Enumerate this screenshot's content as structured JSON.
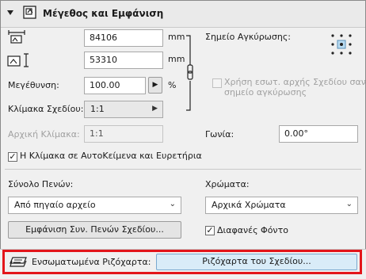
{
  "header": {
    "title": "Μέγεθος και Εμφάνιση"
  },
  "size": {
    "width_value": "84106",
    "width_unit": "mm",
    "height_value": "53310",
    "height_unit": "mm",
    "magnification_label": "Μεγέθυνση:",
    "magnification_value": "100.00",
    "magnification_unit": "%",
    "drawing_scale_label": "Κλίμακα Σχεδίου:",
    "drawing_scale_value": "1:1",
    "original_scale_label": "Αρχική Κλίμακα:",
    "original_scale_value": "1:1"
  },
  "anchor": {
    "label": "Σημείο Αγκύρωσης:",
    "use_origin_label_line1": "Χρήση εσωτ. αρχής Σχεδίου σαν",
    "use_origin_label_line2": "σημείο αγκύρωσης",
    "angle_label": "Γωνία:",
    "angle_value": "0.00°"
  },
  "scale_text_checkbox": {
    "label": "Η Κλίμακα σε ΑυτοΚείμενα και Ευρετήρια",
    "checked": true
  },
  "pens": {
    "label": "Σύνολο Πενών:",
    "selected": "Από πηγαίο αρχείο",
    "show_button": "Εμφάνιση Συν. Πενών Σχεδίου..."
  },
  "colors": {
    "label": "Χρώματα:",
    "selected": "Αρχικά Χρώματα",
    "transparent_label": "Διαφανές Φόντο",
    "transparent_checked": true
  },
  "overrides": {
    "label": "Ενσωματωμένα Ριζόχαρτα:",
    "button": "Ριζόχαρτα του Σχεδίου..."
  }
}
